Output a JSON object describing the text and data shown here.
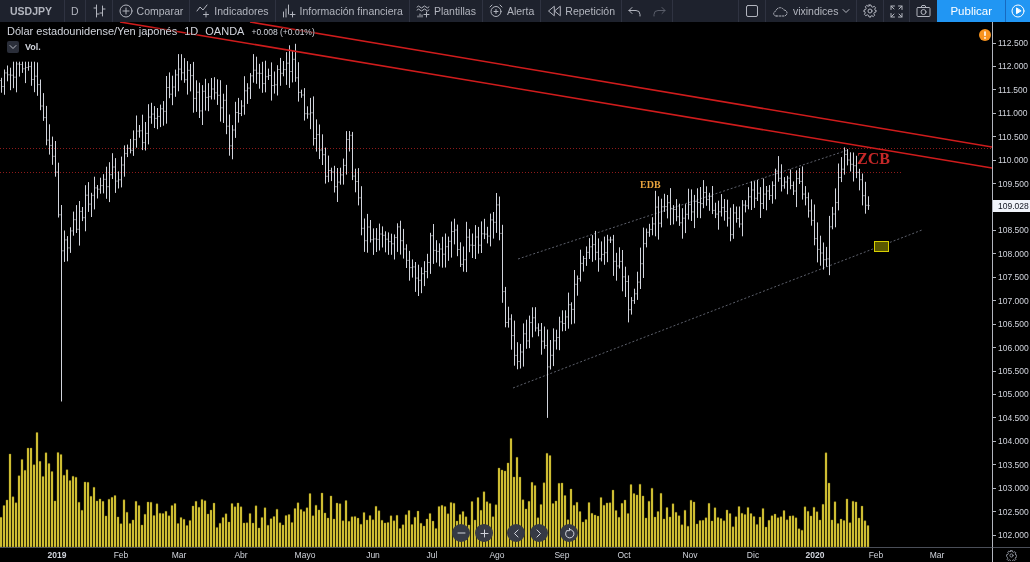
{
  "toolbar": {
    "symbol": "USDJPY",
    "interval": "D",
    "tools": [
      {
        "label": "Comparar"
      },
      {
        "label": "Indicadores"
      },
      {
        "label": "Información financiera"
      },
      {
        "label": "Plantillas"
      },
      {
        "label": "Alerta"
      },
      {
        "label": "Repetición"
      }
    ],
    "history_buttons": [
      {
        "kind": "undo",
        "disabled": false
      },
      {
        "kind": "redo",
        "disabled": true
      }
    ],
    "layout_name": "vixindices",
    "publish_button": "Publicar"
  },
  "legend": {
    "title": "Dólar estadounidense/Yen japonés",
    "interval": "1D",
    "source": "OANDA",
    "change": "+0.008 (+0.01%)",
    "indicator": "Vol."
  },
  "chart": {
    "annotations": [
      {
        "label": "EDB",
        "color": "#e8a33d"
      },
      {
        "label": "ZCB",
        "color": "#c62828"
      }
    ]
  },
  "price_axis": {
    "ticks": [
      {
        "label": "112.500",
        "kind": "tick"
      },
      {
        "label": "112.000",
        "kind": "tick"
      },
      {
        "label": "111.500",
        "kind": "tick"
      },
      {
        "label": "111.000",
        "kind": "tick"
      },
      {
        "label": "110.500",
        "kind": "tick"
      },
      {
        "label": "110.000",
        "kind": "tick"
      },
      {
        "label": "109.500",
        "kind": "tick"
      },
      {
        "label": "109.028",
        "kind": "current"
      },
      {
        "label": "108.500",
        "kind": "tick"
      },
      {
        "label": "108.000",
        "kind": "tick"
      },
      {
        "label": "107.500",
        "kind": "tick"
      },
      {
        "label": "107.000",
        "kind": "tick"
      },
      {
        "label": "106.500",
        "kind": "tick"
      },
      {
        "label": "106.000",
        "kind": "tick"
      },
      {
        "label": "105.500",
        "kind": "tick"
      },
      {
        "label": "105.000",
        "kind": "tick"
      },
      {
        "label": "104.500",
        "kind": "tick"
      },
      {
        "label": "104.000",
        "kind": "tick"
      },
      {
        "label": "103.500",
        "kind": "tick"
      },
      {
        "label": "103.000",
        "kind": "tick"
      },
      {
        "label": "102.500",
        "kind": "tick"
      },
      {
        "label": "102.000",
        "kind": "tick"
      }
    ]
  },
  "time_axis": {
    "ticks": [
      {
        "label": "2019",
        "kind": "year"
      },
      {
        "label": "Feb",
        "kind": "month"
      },
      {
        "label": "Mar",
        "kind": "month"
      },
      {
        "label": "Abr",
        "kind": "month"
      },
      {
        "label": "Mayo",
        "kind": "month"
      },
      {
        "label": "Jun",
        "kind": "month"
      },
      {
        "label": "Jul",
        "kind": "month"
      },
      {
        "label": "Ago",
        "kind": "month"
      },
      {
        "label": "Sep",
        "kind": "month"
      },
      {
        "label": "Oct",
        "kind": "month"
      },
      {
        "label": "Nov",
        "kind": "month"
      },
      {
        "label": "Dic",
        "kind": "month"
      },
      {
        "label": "2020",
        "kind": "year"
      },
      {
        "label": "Feb",
        "kind": "month"
      },
      {
        "label": "Mar",
        "kind": "month"
      }
    ]
  }
}
